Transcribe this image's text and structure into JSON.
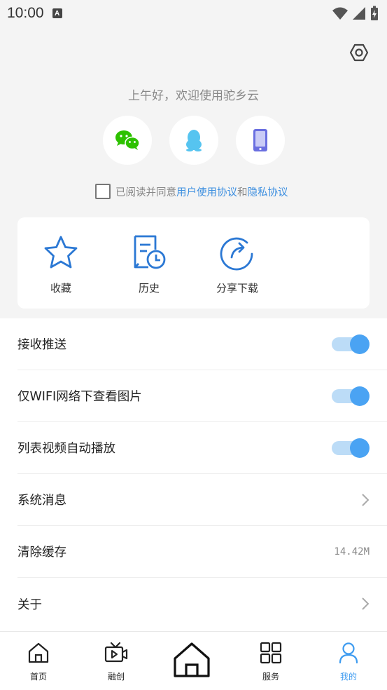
{
  "status_bar": {
    "time": "10:00",
    "notification_badge": "A"
  },
  "header": {
    "greeting": "上午好，欢迎使用驼乡云",
    "login_options": [
      {
        "name": "wechat",
        "icon": "wechat-icon",
        "color": "#2dc100"
      },
      {
        "name": "qq",
        "icon": "qq-penguin-icon",
        "color": "#56c4f0"
      },
      {
        "name": "phone",
        "icon": "phone-icon",
        "color": "#6a6fe0"
      }
    ],
    "agreement": {
      "prefix": "已阅读并同意",
      "user_agreement": "用户使用协议",
      "and": "和",
      "privacy_policy": "隐私协议",
      "checked": false
    }
  },
  "quick_actions": [
    {
      "label": "收藏",
      "icon": "star-icon"
    },
    {
      "label": "历史",
      "icon": "history-icon"
    },
    {
      "label": "分享下载",
      "icon": "share-icon"
    }
  ],
  "settings": [
    {
      "label": "接收推送",
      "type": "toggle",
      "on": true
    },
    {
      "label": "仅WIFI网络下查看图片",
      "type": "toggle",
      "on": true
    },
    {
      "label": "列表视频自动播放",
      "type": "toggle",
      "on": true
    },
    {
      "label": "系统消息",
      "type": "link"
    },
    {
      "label": "清除缓存",
      "type": "value",
      "value": "14.42M"
    },
    {
      "label": "关于",
      "type": "link"
    }
  ],
  "bottom_nav": [
    {
      "label": "首页",
      "icon": "home-icon",
      "active": false
    },
    {
      "label": "融创",
      "icon": "tv-play-icon",
      "active": false
    },
    {
      "label": "",
      "icon": "big-home-icon",
      "active": false
    },
    {
      "label": "服务",
      "icon": "grid-icon",
      "active": false
    },
    {
      "label": "我的",
      "icon": "user-icon",
      "active": true
    }
  ],
  "colors": {
    "accent": "#3d9bf0",
    "link": "#3d8fe0",
    "toggle_knob": "#4aa3f3",
    "toggle_track": "#bcdcf7"
  }
}
